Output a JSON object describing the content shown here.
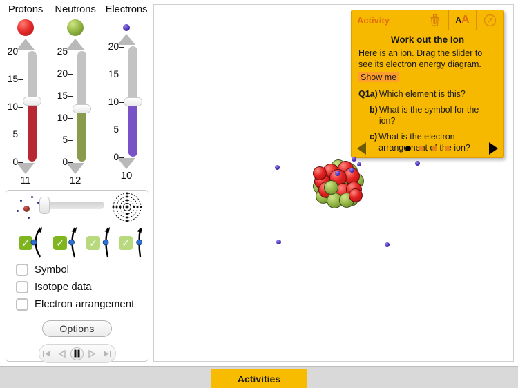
{
  "sliders": [
    {
      "title": "Protons",
      "particle": "proton-swatch",
      "value": "11",
      "value_num": 11,
      "max": 20,
      "ticks": [
        "20",
        "15",
        "10",
        "5",
        "0"
      ],
      "tick_values": [
        20,
        15,
        10,
        5,
        0
      ],
      "color": "#b82832"
    },
    {
      "title": "Neutrons",
      "particle": "neutron-swatch",
      "value": "12",
      "value_num": 12,
      "max": 25,
      "ticks": [
        "25",
        "20",
        "15",
        "10",
        "5",
        "0"
      ],
      "tick_values": [
        25,
        20,
        15,
        10,
        5,
        0
      ],
      "color": "#8a9a4e"
    },
    {
      "title": "Electrons",
      "particle": "electron-swatch",
      "value": "10",
      "value_num": 10,
      "max": 20,
      "ticks": [
        "20",
        "15",
        "10",
        "5",
        "0"
      ],
      "tick_values": [
        20,
        15,
        10,
        5,
        0
      ],
      "color": "#7a52c8"
    }
  ],
  "controls": {
    "model_slider": {
      "left_icon": "atom-model-icon",
      "right_icon": "shell-diagram-icon",
      "position_percent": 12
    },
    "orbit_checkboxes": [
      {
        "checked": true,
        "shade": "dark",
        "check": "✓"
      },
      {
        "checked": true,
        "shade": "dark",
        "check": "✓"
      },
      {
        "checked": true,
        "shade": "light",
        "check": "✓"
      },
      {
        "checked": true,
        "shade": "light",
        "check": "✓"
      }
    ],
    "display_options": [
      {
        "label": "Symbol",
        "checked": false
      },
      {
        "label": "Isotope data",
        "checked": false
      },
      {
        "label": "Electron arrangement",
        "checked": false
      }
    ],
    "options_button": "Options",
    "transport": [
      {
        "name": "skip-back",
        "active": false
      },
      {
        "name": "step-back",
        "active": false
      },
      {
        "name": "pause",
        "active": true
      },
      {
        "name": "step-forward",
        "active": false
      },
      {
        "name": "skip-forward",
        "active": false
      }
    ]
  },
  "activity": {
    "header_label": "Activity",
    "header_buttons": [
      {
        "name": "trash-icon"
      },
      {
        "name": "text-size-icon",
        "label": "AA"
      },
      {
        "name": "reset-icon"
      }
    ],
    "title": "Work out the Ion",
    "intro": "Here is an ion. Drag the slider to see its electron energy diagram.",
    "show_me": "Show me",
    "questions": [
      {
        "label": "Q1a)",
        "text": "Which element is this?",
        "indent": false
      },
      {
        "label": "b)",
        "text": "What is the symbol for the ion?",
        "indent": true
      },
      {
        "label": "c)",
        "text": "What is the electron arrangement of the ion?",
        "indent": true
      }
    ],
    "pagination": {
      "total": 4,
      "current": 1
    },
    "prev_label": "previous-page",
    "next_label": "next-page"
  },
  "canvas": {
    "nucleus": {
      "protons": 11,
      "neutrons": 12,
      "proton_color": "#e32121",
      "neutron_color": "#93b646"
    },
    "free_electrons": 6,
    "electron_color": "#4a2fb8"
  },
  "bottom_bar": {
    "tab_label": "Activities"
  }
}
